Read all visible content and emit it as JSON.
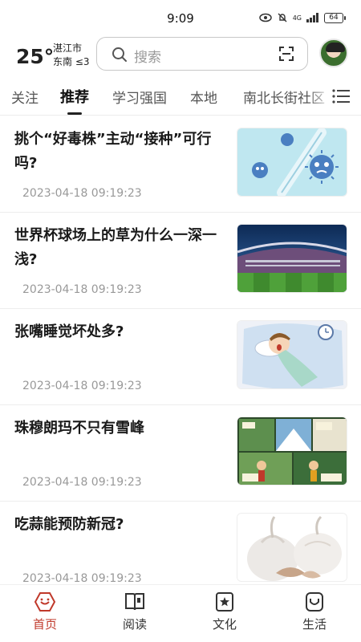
{
  "status": {
    "time": "9:09",
    "network": "4G",
    "battery": "64"
  },
  "header": {
    "temperature": "25°",
    "city": "湛江市",
    "wind": "东南 ≤3",
    "search_placeholder": "搜索"
  },
  "tabs": [
    {
      "label": "关注"
    },
    {
      "label": "推荐",
      "active": true
    },
    {
      "label": "学习强国"
    },
    {
      "label": "本地"
    },
    {
      "label": "南北长街社区"
    }
  ],
  "news": [
    {
      "title": "挑个“好毒株”主动“接种”可行吗?",
      "time": "2023-04-18 09:19:23",
      "thumb": "virus-illustration"
    },
    {
      "title": "世界杯球场上的草为什么一深一浅?",
      "time": "2023-04-18 09:19:23",
      "thumb": "stadium-photo"
    },
    {
      "title": "张嘴睡觉坏处多?",
      "time": "2023-04-18 09:19:23",
      "thumb": "sleeping-boy-illustration"
    },
    {
      "title": "珠穆朗玛不只有雪峰",
      "time": "2023-04-18 09:19:23",
      "thumb": "comic-panels"
    },
    {
      "title": "吃蒜能预防新冠?",
      "time": "2023-04-18 09:19:23",
      "thumb": "garlic-photo"
    }
  ],
  "bottom_nav": [
    {
      "label": "首页",
      "icon": "home-icon",
      "active": true
    },
    {
      "label": "阅读",
      "icon": "book-icon"
    },
    {
      "label": "文化",
      "icon": "culture-icon"
    },
    {
      "label": "生活",
      "icon": "life-icon"
    }
  ],
  "colors": {
    "accent": "#c0392b",
    "text": "#1a1a1a",
    "muted": "#999999"
  }
}
